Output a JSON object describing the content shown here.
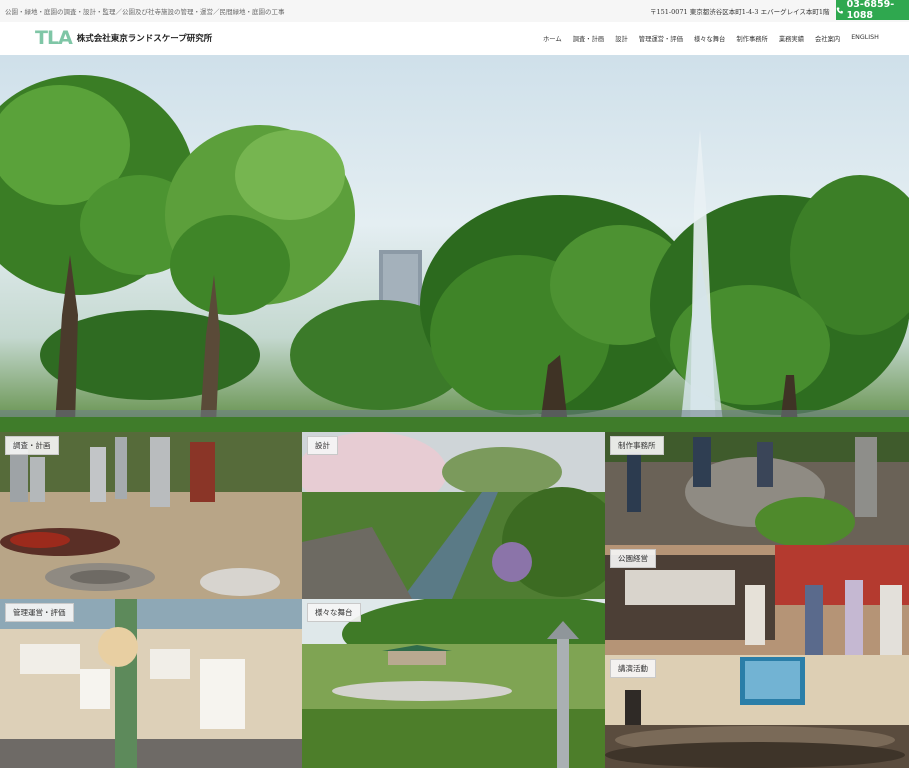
{
  "header": {
    "tagline": "公園・緑地・庭園の調査・設計・監理／公園及び社寺施設の管理・運営／民間緑地・庭園の工事",
    "address": "〒151-0071 東京都渋谷区本町1-4-3 エバーグレイス本町1階",
    "phone": "03-6859-1088",
    "phone_icon": "phone-icon",
    "accent_color": "#2fa84f"
  },
  "logo": {
    "mark": "TLA",
    "company": "株式会社東京ランドスケープ研究所"
  },
  "nav": {
    "items": [
      "ホーム",
      "調査・計画",
      "設計",
      "管理運営・評価",
      "様々な舞台",
      "制作事務所",
      "業務実績",
      "会社案内",
      "ENGLISH"
    ]
  },
  "hero": {
    "slide_count": 3,
    "active_slide": 1
  },
  "tiles": [
    {
      "label": "調査・計画"
    },
    {
      "label": "設計"
    },
    {
      "label": "制作事務所"
    },
    {
      "label": "公園経営"
    },
    {
      "label": "管理運営・評価"
    },
    {
      "label": "様々な舞台"
    },
    {
      "label": "講演活動"
    }
  ]
}
